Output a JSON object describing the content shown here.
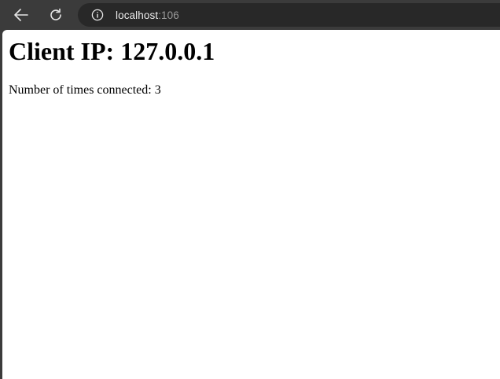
{
  "browser": {
    "address_bar": {
      "host": "localhost",
      "port": ":106"
    },
    "icons": {
      "back": "arrow-left-icon",
      "reload": "reload-icon",
      "info": "info-icon"
    },
    "colors": {
      "chrome_background": "#3b3b3b",
      "address_bar_background": "#282828",
      "page_background": "#ffffff"
    }
  },
  "page": {
    "heading": "Client IP: 127.0.0.1",
    "connection_text": "Number of times connected: 3"
  }
}
